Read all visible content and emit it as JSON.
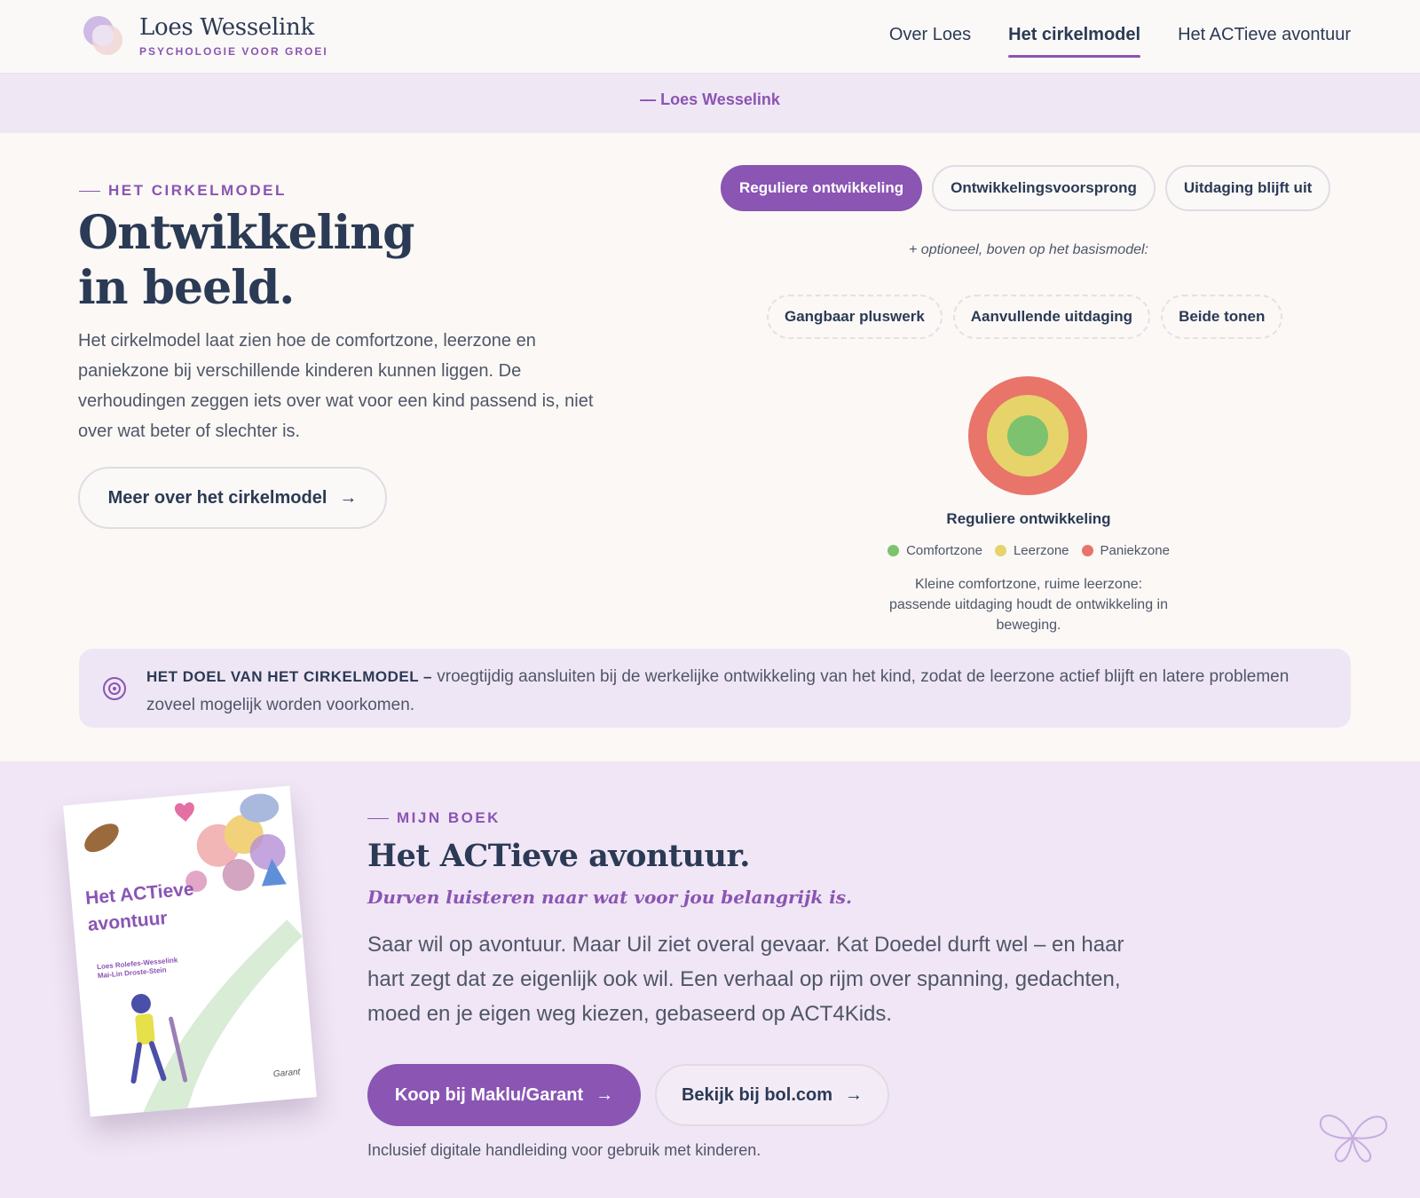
{
  "header": {
    "brand_name": "Loes Wesselink",
    "brand_tagline": "PSYCHOLOGIE VOOR GROEI",
    "nav": [
      {
        "label": "Over Loes",
        "active": false
      },
      {
        "label": "Het cirkelmodel",
        "active": true
      },
      {
        "label": "Het ACTieve avontuur",
        "active": false
      }
    ]
  },
  "quote": {
    "author": "— Loes Wesselink"
  },
  "cirkelmodel": {
    "eyebrow": "HET CIRKELMODEL",
    "title_line1": "Ontwikkeling",
    "title_line2": "in beeld.",
    "body": "Het cirkelmodel laat zien hoe de comfortzone, leerzone en paniekzone bij verschillende kinderen kunnen liggen. De verhoudingen zeggen iets over wat voor een kind passend is, niet over wat beter of slechter is.",
    "more_button": "Meer over het cirkelmodel",
    "tabs": [
      {
        "label": "Reguliere ontwikkeling",
        "active": true
      },
      {
        "label": "Ontwikkelingsvoorsprong",
        "active": false
      },
      {
        "label": "Uitdaging blijft uit",
        "active": false
      }
    ],
    "optional_note": "+ optioneel, boven op het basismodel:",
    "options": [
      "Gangbaar pluswerk",
      "Aanvullende uitdaging",
      "Beide tonen"
    ],
    "diagram_caption": "Reguliere ontwikkeling",
    "legend": [
      {
        "label": "Comfortzone",
        "color": "#7cc26f"
      },
      {
        "label": "Leerzone",
        "color": "#e6d36a"
      },
      {
        "label": "Paniekzone",
        "color": "#e8746a"
      }
    ],
    "description": "Kleine comfortzone, ruime leerzone: passende uitdaging houdt de ontwikkeling in beweging.",
    "goal_label": "HET DOEL VAN HET CIRKELMODEL –",
    "goal_text": " vroegtijdig aansluiten bij de werkelijke ontwikkeling van het kind, zodat de leerzone actief blijft en latere problemen zoveel mogelijk worden voorkomen."
  },
  "book": {
    "cover_title_line1": "Het ACTieve",
    "cover_title_line2": "avontuur",
    "cover_author1": "Loes Rolefes-Wesselink",
    "cover_author2": "Mai-Lin Droste-Stein",
    "cover_publisher": "Garant",
    "eyebrow": "MIJN BOEK",
    "title": "Het ACTieve avontuur.",
    "subtitle": "Durven luisteren naar wat voor jou belangrijk is.",
    "body": "Saar wil op avontuur. Maar Uil ziet overal gevaar. Kat Doedel durft wel – en haar hart zegt dat ze eigenlijk ook wil. Een verhaal op rijm over spanning, gedachten, moed en je eigen weg kiezen, gebaseerd op ACT4Kids.",
    "buy_button": "Koop bij Maklu/Garant",
    "bol_button": "Bekijk bij bol.com",
    "note": "Inclusief digitale handleiding voor gebruik met kinderen."
  },
  "icons": {
    "arrow": "→"
  },
  "colors": {
    "accent": "#8a55b3",
    "text": "#2b3a55",
    "comfort": "#7cc26f",
    "leer": "#e6d36a",
    "paniek": "#e8746a"
  }
}
